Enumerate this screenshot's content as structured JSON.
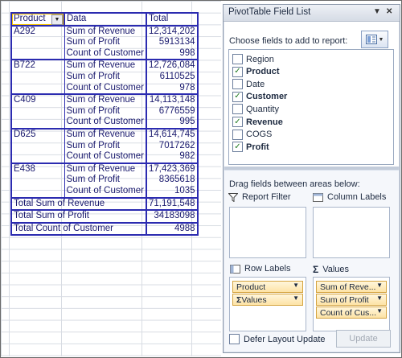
{
  "pivot": {
    "headers": {
      "row_field": "Product",
      "data_field": "Data",
      "total": "Total"
    },
    "groups": [
      {
        "product": "A292",
        "rows": [
          {
            "label": "Sum of Revenue",
            "value": "12,314,202"
          },
          {
            "label": "Sum of Profit",
            "value": "5913134"
          },
          {
            "label": "Count of Customer",
            "value": "998"
          }
        ]
      },
      {
        "product": "B722",
        "rows": [
          {
            "label": "Sum of Revenue",
            "value": "12,726,084"
          },
          {
            "label": "Sum of Profit",
            "value": "6110525"
          },
          {
            "label": "Count of Customer",
            "value": "978"
          }
        ]
      },
      {
        "product": "C409",
        "rows": [
          {
            "label": "Sum of Revenue",
            "value": "14,113,148"
          },
          {
            "label": "Sum of Profit",
            "value": "6776559"
          },
          {
            "label": "Count of Customer",
            "value": "995"
          }
        ]
      },
      {
        "product": "D625",
        "rows": [
          {
            "label": "Sum of Revenue",
            "value": "14,614,745"
          },
          {
            "label": "Sum of Profit",
            "value": "7017262"
          },
          {
            "label": "Count of Customer",
            "value": "982"
          }
        ]
      },
      {
        "product": "E438",
        "rows": [
          {
            "label": "Sum of Revenue",
            "value": "17,423,369"
          },
          {
            "label": "Sum of Profit",
            "value": "8365618"
          },
          {
            "label": "Count of Customer",
            "value": "1035"
          }
        ]
      }
    ],
    "totals": [
      {
        "label": "Total Sum of Revenue",
        "value": "71,191,548"
      },
      {
        "label": "Total Sum of Profit",
        "value": "34183098"
      },
      {
        "label": "Total Count of Customer",
        "value": "4988"
      }
    ]
  },
  "field_list": {
    "title": "PivotTable Field List",
    "choose_label": "Choose fields to add to report:",
    "fields": [
      {
        "name": "Region",
        "checked": false
      },
      {
        "name": "Product",
        "checked": true
      },
      {
        "name": "Date",
        "checked": false
      },
      {
        "name": "Customer",
        "checked": true
      },
      {
        "name": "Quantity",
        "checked": false
      },
      {
        "name": "Revenue",
        "checked": true
      },
      {
        "name": "COGS",
        "checked": false
      },
      {
        "name": "Profit",
        "checked": true
      }
    ],
    "drag_label": "Drag fields between areas below:",
    "report_filter_label": "Report Filter",
    "column_labels_label": "Column Labels",
    "row_labels_label": "Row Labels",
    "values_label": "Values",
    "row_items": [
      "Product",
      "Values"
    ],
    "value_items": [
      "Sum of Reve...",
      "Sum of Profit",
      "Count of Cus..."
    ],
    "defer_label": "Defer Layout Update",
    "update_label": "Update"
  }
}
